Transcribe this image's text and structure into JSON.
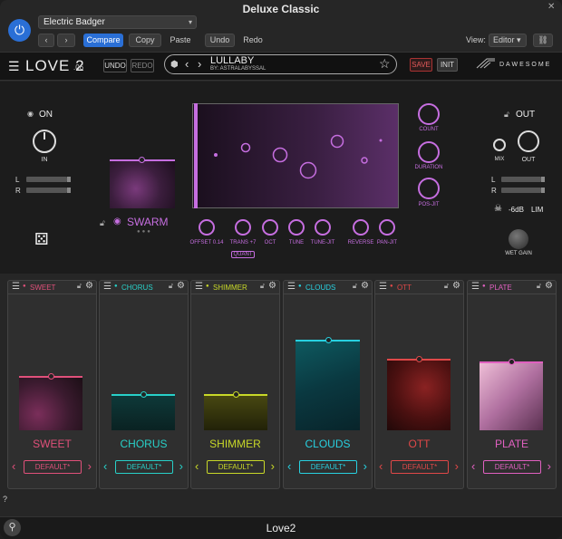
{
  "window": {
    "title": "Deluxe Classic",
    "footer_title": "Love2",
    "help": "?"
  },
  "toolbar": {
    "preset": "Electric Badger",
    "compare": "Compare",
    "copy": "Copy",
    "paste": "Paste",
    "undo": "Undo",
    "redo": "Redo",
    "view_label": "View:",
    "view_value": "Editor"
  },
  "header": {
    "logo": "LOVE 2",
    "version": ".06",
    "undo": "UNDO",
    "redo": "REDO",
    "preset_name": "LULLABY",
    "preset_author": "BY: ASTRALABYSSAL",
    "save": "SAVE",
    "init": "INIT",
    "brand": "DAWESOME"
  },
  "input": {
    "on": "ON",
    "in": "IN",
    "l": "L",
    "r": "R"
  },
  "engine": {
    "name": "SWARM",
    "offset": "OFFSET 0.14",
    "trans": "TRANS +7",
    "quant": "QUANT",
    "oct": "OCT",
    "tune": "TUNE",
    "tune_jit": "TUNE-JIT",
    "reverse": "REVERSE",
    "pan_jit": "PAN-JIT",
    "count": "COUNT",
    "duration": "DURATION",
    "pos_jit": "POS-JIT"
  },
  "output": {
    "out_toggle": "OUT",
    "mix": "MIX",
    "out": "OUT",
    "l": "L",
    "r": "R",
    "limit_value": "-6dB",
    "limit": "LIM",
    "wet_gain": "WET GAIN"
  },
  "effects": [
    {
      "title": "SWEET",
      "name": "SWEET",
      "preset": "DEFAULT*",
      "color": "#e0507a"
    },
    {
      "title": "CHORUS",
      "name": "CHORUS",
      "preset": "DEFAULT*",
      "color": "#28d0c8"
    },
    {
      "title": "SHIMMER",
      "name": "SHIMMER",
      "preset": "DEFAULT*",
      "color": "#c8d828"
    },
    {
      "title": "CLOUDS",
      "name": "CLOUDS",
      "preset": "DEFAULT*",
      "color": "#28d0e0"
    },
    {
      "title": "OTT",
      "name": "OTT",
      "preset": "DEFAULT*",
      "color": "#e04848"
    },
    {
      "title": "PLATE",
      "name": "PLATE",
      "preset": "DEFAULT*",
      "color": "#e060c0"
    }
  ]
}
